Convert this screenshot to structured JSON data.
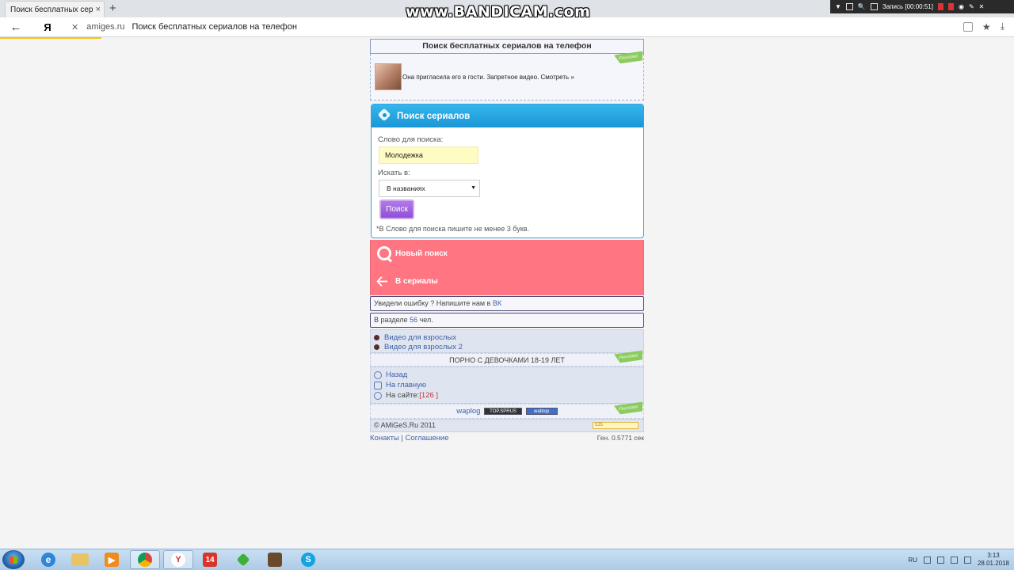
{
  "browser": {
    "tab_title": "Поиск бесплатных сериа",
    "tab_close": "×",
    "new_tab": "+",
    "back": "←",
    "yandex": "Я",
    "stop": "✕",
    "domain": "amiges.ru",
    "page_title": "Поиск бесплатных сериалов на телефон",
    "star": "★",
    "download": "⤓"
  },
  "overlay": {
    "watermark": "www.BANDICAM.com",
    "record_label": "Запись [00:00:51]"
  },
  "page": {
    "header": "Поиск бесплатных сериалов на телефон",
    "ad_text": "Она пригласила его в гости. Запретное видео. Смотреть »",
    "ribbon": "Реклама",
    "search": {
      "title": "Поиск сериалов",
      "word_label": "Слово для поиска:",
      "word_value": "Молодежка",
      "in_label": "Искать в:",
      "in_value": "В названиях",
      "caret": "▼",
      "button": "Поиск",
      "note": "*В Слово для поиска пишите не менее 3 букв."
    },
    "new_search": "Новый поиск",
    "to_series": "В сериалы",
    "arrow": "🡠",
    "error_text": "Увидели ошибку ? Напишите нам в ",
    "error_link": "ВК",
    "section_prefix": "В разделе ",
    "section_count": "56",
    "section_suffix": " чел.",
    "links": [
      "Видео для взрослых",
      "Видео для взрослых 2"
    ],
    "promo": "ПОРНО С ДЕВОЧКАМИ 18-19 ЛЕТ",
    "nav": {
      "back": "Назад",
      "home": "На главную",
      "online_prefix": "На сайте: ",
      "online_count": "[126 ]"
    },
    "counter": {
      "waplog": "waplog",
      "badge1": "TOP.SPRUS",
      "badge2": "wabtop"
    },
    "copyright": "© AMiGeS.Ru 2011",
    "mini_banner": "535",
    "contacts": "Конакты",
    "separator": " | ",
    "agreement": "Соглашение",
    "gen": "Ген. 0.5771 сек"
  },
  "taskbar": {
    "lang": "RU",
    "time": "3:13",
    "date": "28.01.2018",
    "apps": [
      "internet-explorer",
      "file-explorer",
      "media-player",
      "chrome",
      "yandex-browser",
      "app-14",
      "sims",
      "game",
      "skype"
    ],
    "app14_label": "14",
    "yandex_label": "Y",
    "skype_label": "S"
  }
}
